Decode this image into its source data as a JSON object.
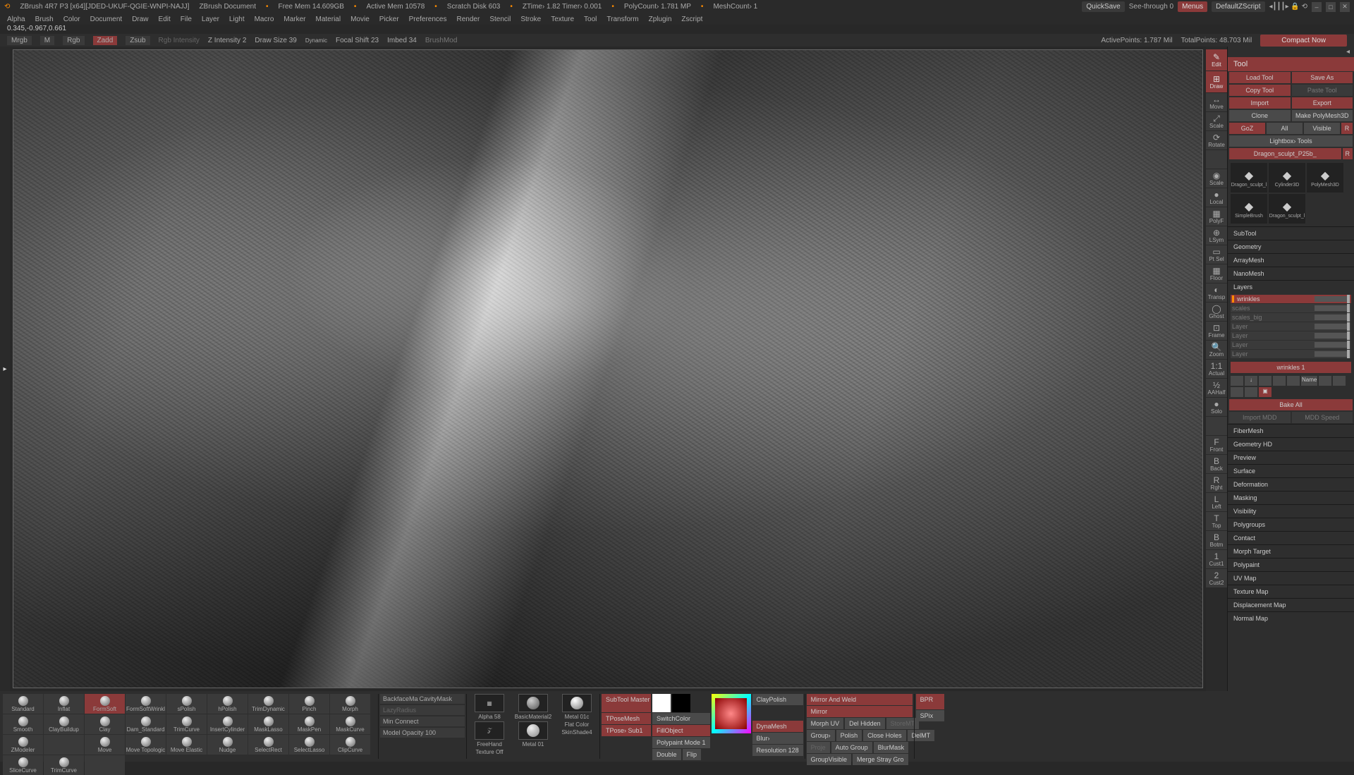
{
  "domain": "Computer-Use",
  "topbar": {
    "app": "ZBrush 4R7 P3  [x64][JDED-UKUF-QGIE-WNPI-NAJJ]",
    "doc": "ZBrush Document",
    "free_mem": "Free Mem 14.609GB",
    "active_mem": "Active Mem 10578",
    "scratch": "Scratch Disk 603",
    "ztime": "ZTime› 1.82 Timer› 0.001",
    "polycount": "PolyCount› 1.781 MP",
    "meshcount": "MeshCount› 1",
    "quicksave": "QuickSave",
    "seethrough": "See-through   0",
    "menus": "Menus",
    "default_script": "DefaultZScript"
  },
  "menu": [
    "Alpha",
    "Brush",
    "Color",
    "Document",
    "Draw",
    "Edit",
    "File",
    "Layer",
    "Light",
    "Macro",
    "Marker",
    "Material",
    "Movie",
    "Picker",
    "Preferences",
    "Render",
    "Stencil",
    "Stroke",
    "Texture",
    "Tool",
    "Transform",
    "Zplugin",
    "Zscript"
  ],
  "coords": "0.345,-0.967,0.661",
  "topshelf": {
    "mrgb": "Mrgb",
    "m": "M",
    "rgb": "Rgb",
    "zadd": "Zadd",
    "zsub": "Zsub",
    "rgb_intensity": "Rgb Intensity",
    "z_intensity": "Z Intensity 2",
    "draw_size": "Draw Size 39",
    "dynamic": "Dynamic",
    "focal_shift": "Focal Shift 23",
    "imbed": "Imbed 34",
    "brushmod": "BrushMod",
    "active_pts": "ActivePoints: 1.787 Mil",
    "total_pts": "TotalPoints: 48.703 Mil",
    "compact": "Compact Now"
  },
  "right_rail": [
    "Edit",
    "Draw",
    "Move",
    "Scale",
    "Rotate",
    "",
    "Scale",
    "Local",
    "PolyF",
    "LSym",
    "Pt Sel",
    "Floor",
    "Transp",
    "Ghost",
    "Frame",
    "Zoom",
    "Actual",
    "AAHalf",
    "Solo",
    "",
    "Front",
    "Back",
    "Rght",
    "Left",
    "Top",
    "Botm",
    "Cust1",
    "Cust2"
  ],
  "tool": {
    "header": "Tool",
    "row1": [
      "Load Tool",
      "Save As"
    ],
    "row2": [
      "Copy Tool",
      "Paste Tool"
    ],
    "row3": [
      "Import",
      "Export"
    ],
    "row4": [
      "Clone",
      "Make PolyMesh3D"
    ],
    "row5": [
      "GoZ",
      "All",
      "Visible",
      "R"
    ],
    "lightbox": "Lightbox› Tools",
    "current": "Dragon_sculpt_P25b_",
    "thumbs": [
      {
        "name": "Dragon_sculpt_l"
      },
      {
        "name": "Cylinder3D"
      },
      {
        "name": "PolyMesh3D"
      },
      {
        "name": "SimpleBrush"
      },
      {
        "name": "Dragon_sculpt_l"
      }
    ],
    "subpalettes": [
      "SubTool",
      "Geometry",
      "ArrayMesh",
      "NanoMesh"
    ],
    "layers": {
      "header": "Layers",
      "items": [
        "wrinkles",
        "scales",
        "scales_big",
        "Layer",
        "Layer",
        "Layer",
        "Layer"
      ],
      "current": "wrinkles 1",
      "buttons": [
        "",
        "↓",
        "",
        "",
        "",
        "Name",
        "",
        "",
        "",
        "",
        "▣"
      ],
      "bake": "Bake All",
      "import": "Import MDD",
      "speed": "MDD Speed"
    },
    "more": [
      "FiberMesh",
      "Geometry HD",
      "Preview",
      "Surface",
      "Deformation",
      "Masking",
      "Visibility",
      "Polygroups",
      "Contact",
      "Morph Target",
      "Polypaint",
      "UV Map",
      "Texture Map",
      "Displacement Map",
      "Normal Map"
    ]
  },
  "brushes_row1": [
    "Standard",
    "Inflat",
    "FormSoft",
    "FormSoftWrinkl",
    "sPolish",
    "hPolish",
    "TrimDynamic",
    "Pinch",
    "Morph",
    "Smooth"
  ],
  "brushes_row2": [
    "ClayBuildup",
    "Clay",
    "Dam_Standard",
    "TrimCurve",
    "InsertCylinder",
    "MaskLasso",
    "MaskPen",
    "MaskCurve",
    "ZModeler",
    ""
  ],
  "brushes_row3": [
    "Move",
    "Move Topologic",
    "Move Elastic",
    "Nudge",
    "SelectRect",
    "SelectLasso",
    "ClipCurve",
    "SliceCurve",
    "TrimCurve",
    ""
  ],
  "brush_opts": {
    "backface": "BackfaceMa",
    "cavity": "CavityMask",
    "lazy": "LazyRadius",
    "minconn": "Min Connect",
    "opacity": "Model Opacity 100"
  },
  "alpha": {
    "label": "Alpha 58",
    "stroke": "FreeHand",
    "tex_off": "Texture Off"
  },
  "mat": {
    "basic": "BasicMaterial2",
    "metal": "Metal 01",
    "metal01c": "Metal 01c",
    "flat": "Flat Color",
    "skin": "SkinShade4"
  },
  "subtool_master": {
    "label": "SubTool Master",
    "tpose": "TPoseMesh",
    "tposesub": "TPose› Sub1"
  },
  "colors": {
    "switch": "SwitchColor",
    "fill": "FillObject",
    "mode": "Polypaint Mode 1",
    "double": "Double",
    "flip": "Flip"
  },
  "claypolish": "ClayPolish",
  "dynamesh": "DynaMesh",
  "blur": "Blur›",
  "resolution": "Resolution 128",
  "mirror": {
    "weld": "Mirror And Weld",
    "mirror": "Mirror",
    "morph": "Morph UV",
    "del_hidden": "Del Hidden",
    "store": "StoreMT",
    "group": "Group›",
    "polish": "Polish",
    "close": "Close Holes",
    "delmt": "DelMT",
    "proj": "Proje",
    "auto": "Auto Group",
    "blurmask": "BlurMask",
    "gvis": "GroupVisible",
    "merge": "Merge Stray Gro"
  },
  "bpr": "BPR",
  "spix": "SPix"
}
